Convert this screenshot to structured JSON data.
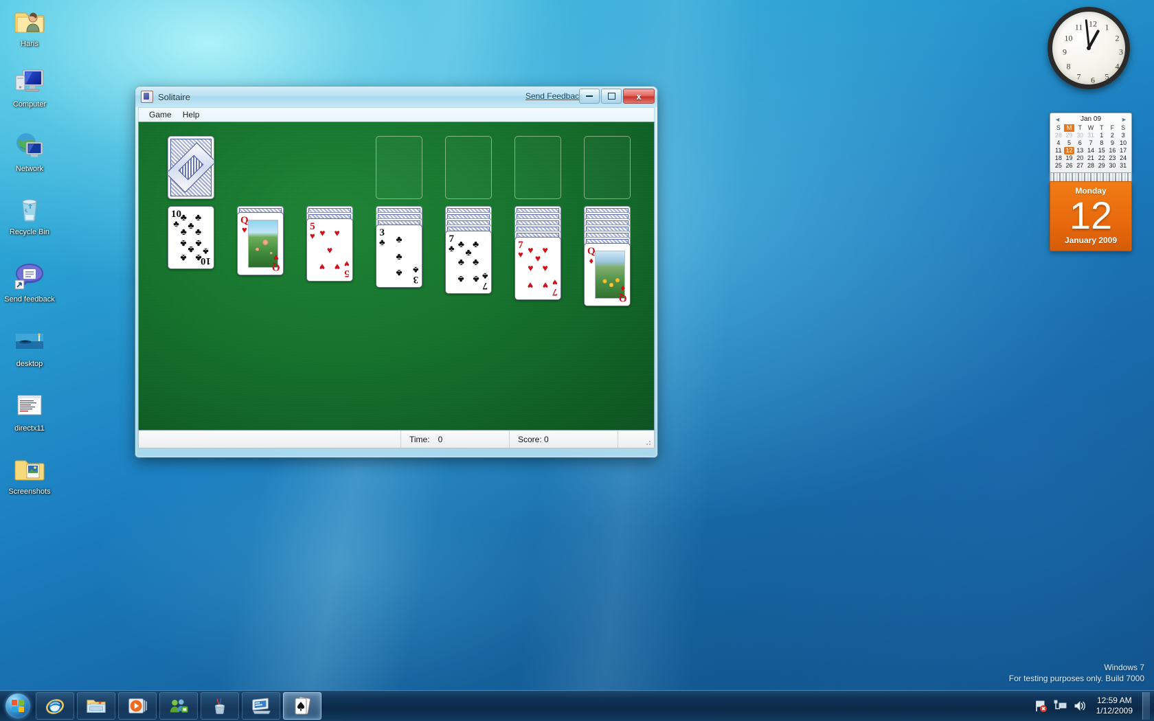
{
  "desktop": {
    "icons": [
      {
        "label": "Haris",
        "icon": "user-folder-icon"
      },
      {
        "label": "Computer",
        "icon": "computer-icon"
      },
      {
        "label": "Network",
        "icon": "network-icon"
      },
      {
        "label": "Recycle Bin",
        "icon": "recycle-bin-icon"
      },
      {
        "label": "Send feedback",
        "icon": "send-feedback-icon"
      },
      {
        "label": "desktop",
        "icon": "desktop-image-icon"
      },
      {
        "label": "directx11",
        "icon": "text-document-icon"
      },
      {
        "label": "Screenshots",
        "icon": "pictures-folder-icon"
      }
    ],
    "watermark": {
      "line1": "Windows 7",
      "line2": "For testing purposes only. Build 7000"
    }
  },
  "solitaire": {
    "title": "Solitaire",
    "title_icon": "playing-card-icon",
    "send_feedback_label": "Send Feedback",
    "window_buttons": {
      "minimize": "minimize-icon",
      "maximize": "maximize-icon",
      "close": "close-icon",
      "close_glyph": "x"
    },
    "menus": [
      {
        "label": "Game"
      },
      {
        "label": "Help"
      }
    ],
    "status": {
      "time_label": "Time:",
      "time_value": "0",
      "score_label": "Score: 0"
    },
    "board": {
      "felt_color": "#14732c",
      "stock": {
        "type": "card-back",
        "name": "stock-pile"
      },
      "waste": {
        "type": "empty",
        "name": "waste-pile"
      },
      "foundations": [
        {
          "name": "foundation-1"
        },
        {
          "name": "foundation-2"
        },
        {
          "name": "foundation-3"
        },
        {
          "name": "foundation-4"
        }
      ],
      "tableau": [
        {
          "name": "tableau-column-1",
          "facedown": 0,
          "rank": "10",
          "suit": "♣",
          "color": "black",
          "pip_layout": "10",
          "picture": null
        },
        {
          "name": "tableau-column-2",
          "facedown": 1,
          "rank": "Q",
          "suit": "♥",
          "color": "red",
          "pip_layout": "face",
          "picture": "rose"
        },
        {
          "name": "tableau-column-3",
          "facedown": 2,
          "rank": "5",
          "suit": "♥",
          "color": "red",
          "pip_layout": "5",
          "picture": null
        },
        {
          "name": "tableau-column-4",
          "facedown": 3,
          "rank": "3",
          "suit": "♣",
          "color": "black",
          "pip_layout": "3",
          "picture": null
        },
        {
          "name": "tableau-column-5",
          "facedown": 4,
          "rank": "7",
          "suit": "♣",
          "color": "black",
          "pip_layout": "7",
          "picture": null
        },
        {
          "name": "tableau-column-6",
          "facedown": 5,
          "rank": "7",
          "suit": "♥",
          "color": "red",
          "pip_layout": "7",
          "picture": null
        },
        {
          "name": "tableau-column-7",
          "facedown": 6,
          "rank": "Q",
          "suit": "♦",
          "color": "red",
          "pip_layout": "face",
          "picture": "tulip"
        }
      ]
    }
  },
  "gadgets": {
    "clock": {
      "name": "analog-clock-gadget",
      "hour_hand_deg": 389,
      "minute_hand_deg": 354,
      "numbers": [
        "12",
        "1",
        "2",
        "3",
        "4",
        "5",
        "6",
        "7",
        "8",
        "9",
        "10",
        "11"
      ]
    },
    "calendar": {
      "name": "calendar-gadget",
      "month_label": "Jan 09",
      "prev_arrow": "◄",
      "next_arrow": "►",
      "day_headers": [
        "S",
        "M",
        "T",
        "W",
        "T",
        "F",
        "S"
      ],
      "highlighted_day_header_index": 1,
      "weeks": [
        [
          {
            "d": "28",
            "mute": true
          },
          {
            "d": "29",
            "mute": true
          },
          {
            "d": "30",
            "mute": true
          },
          {
            "d": "31",
            "mute": true
          },
          {
            "d": "1"
          },
          {
            "d": "2"
          },
          {
            "d": "3"
          }
        ],
        [
          {
            "d": "4"
          },
          {
            "d": "5"
          },
          {
            "d": "6"
          },
          {
            "d": "7"
          },
          {
            "d": "8"
          },
          {
            "d": "9"
          },
          {
            "d": "10"
          }
        ],
        [
          {
            "d": "11"
          },
          {
            "d": "12",
            "today": true
          },
          {
            "d": "13"
          },
          {
            "d": "14"
          },
          {
            "d": "15"
          },
          {
            "d": "16"
          },
          {
            "d": "17"
          }
        ],
        [
          {
            "d": "18"
          },
          {
            "d": "19"
          },
          {
            "d": "20"
          },
          {
            "d": "21"
          },
          {
            "d": "22"
          },
          {
            "d": "23"
          },
          {
            "d": "24"
          }
        ],
        [
          {
            "d": "25"
          },
          {
            "d": "26"
          },
          {
            "d": "27"
          },
          {
            "d": "28"
          },
          {
            "d": "29"
          },
          {
            "d": "30"
          },
          {
            "d": "31"
          }
        ]
      ],
      "weekday": "Monday",
      "day_number": "12",
      "month_year": "January 2009"
    }
  },
  "taskbar": {
    "start_button": "start-orb",
    "buttons": [
      {
        "name": "taskbar-internet-explorer",
        "icon": "internet-explorer-icon",
        "active": false
      },
      {
        "name": "taskbar-windows-explorer",
        "icon": "folder-icon",
        "active": false
      },
      {
        "name": "taskbar-windows-media-player",
        "icon": "media-player-icon",
        "active": false
      },
      {
        "name": "taskbar-messenger",
        "icon": "messenger-icon",
        "active": false
      },
      {
        "name": "taskbar-sticky-notes",
        "icon": "pen-cup-icon",
        "active": false
      },
      {
        "name": "taskbar-gadgets",
        "icon": "gadget-icon",
        "active": false
      },
      {
        "name": "taskbar-solitaire",
        "icon": "playing-card-icon",
        "active": true
      }
    ],
    "tray": {
      "icons": [
        {
          "name": "action-center-icon",
          "glyph": "flag-with-error"
        },
        {
          "name": "network-icon",
          "glyph": "network"
        },
        {
          "name": "volume-icon",
          "glyph": "speaker"
        }
      ],
      "time": "12:59 AM",
      "date": "1/12/2009"
    },
    "show_desktop": "show-desktop-button"
  }
}
